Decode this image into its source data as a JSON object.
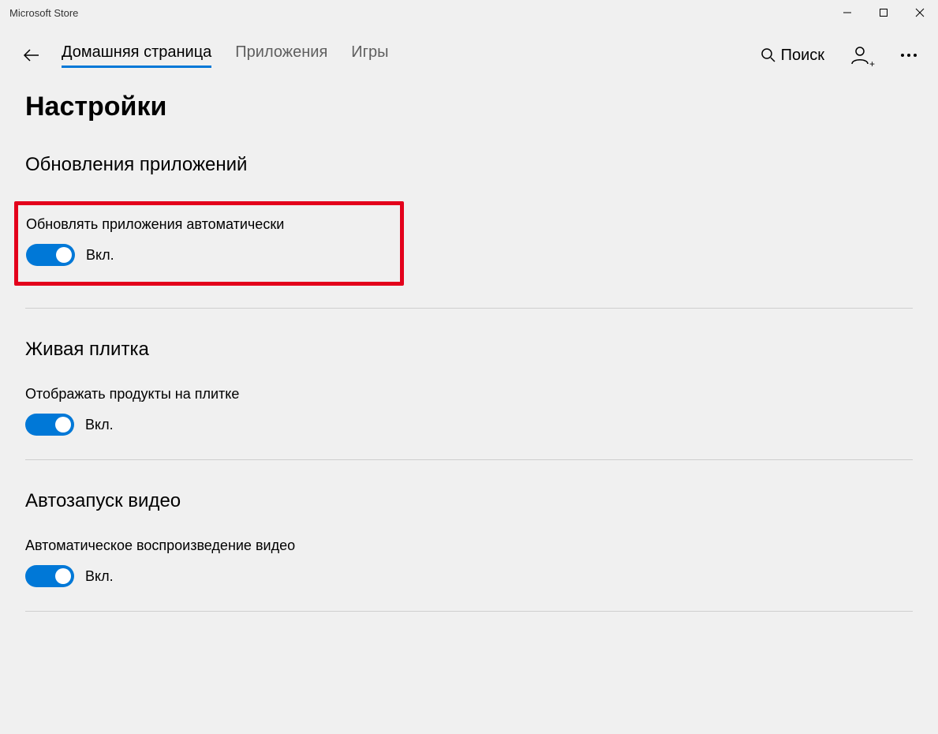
{
  "titlebar": {
    "title": "Microsoft Store"
  },
  "nav": {
    "tabs": {
      "home": "Домашняя страница",
      "apps": "Приложения",
      "games": "Игры"
    },
    "search_label": "Поиск"
  },
  "page": {
    "title": "Настройки"
  },
  "sections": {
    "app_updates": {
      "heading": "Обновления приложений",
      "setting_label": "Обновлять приложения автоматически",
      "toggle_state": "Вкл."
    },
    "live_tile": {
      "heading": "Живая плитка",
      "setting_label": "Отображать продукты на плитке",
      "toggle_state": "Вкл."
    },
    "autoplay": {
      "heading": "Автозапуск видео",
      "setting_label": "Автоматическое воспроизведение видео",
      "toggle_state": "Вкл."
    }
  },
  "colors": {
    "accent": "#0078d7",
    "highlight": "#e3001b"
  }
}
